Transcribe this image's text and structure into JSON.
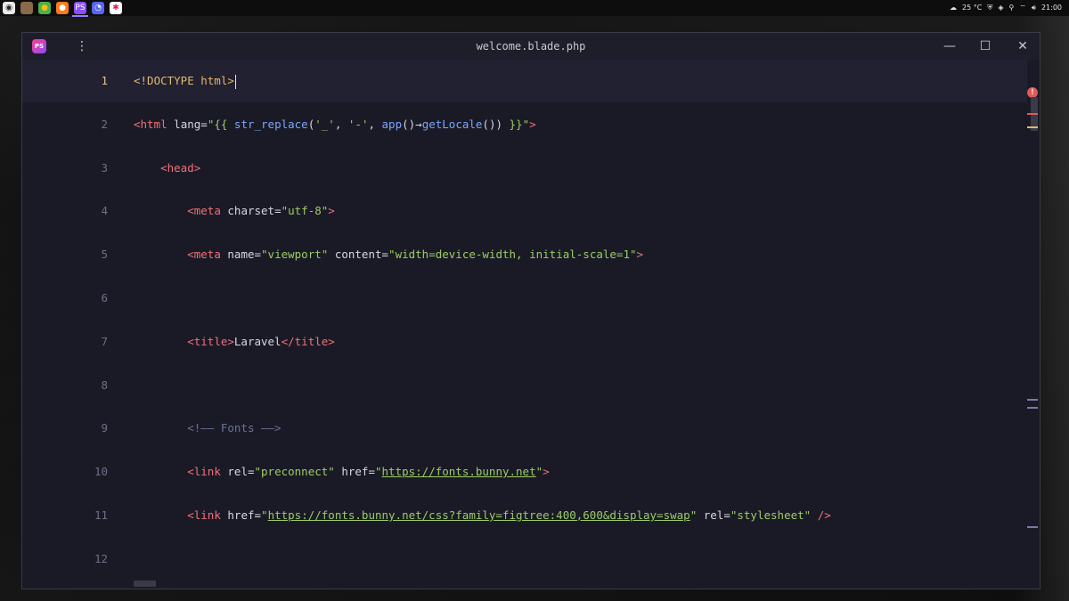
{
  "taskbar": {
    "apps": [
      {
        "name": "linux-mint-menu-icon",
        "glyph": "◉",
        "bg": "#e9e9e9",
        "fg": "#222"
      },
      {
        "name": "files-icon",
        "glyph": "▬",
        "bg": "#8a6a4a",
        "fg": "#8a6a4a"
      },
      {
        "name": "chrome-icon",
        "glyph": "●",
        "bg": "#4caf50",
        "fg": "#f4c20d"
      },
      {
        "name": "firefox-icon",
        "glyph": "●",
        "bg": "#ff7a1a",
        "fg": "#fff"
      },
      {
        "name": "phpstorm-icon",
        "glyph": "PS",
        "bg": "#8b4dff",
        "fg": "#fff"
      },
      {
        "name": "discord-icon",
        "glyph": "◔",
        "bg": "#5865f2",
        "fg": "#fff"
      },
      {
        "name": "slack-icon",
        "glyph": "✱",
        "bg": "#ffffff",
        "fg": "#e01e5a"
      }
    ],
    "weather": "25 °C",
    "clock": "21:00"
  },
  "window": {
    "title": "welcome.blade.php"
  },
  "editor": {
    "lines": [
      {
        "n": "1",
        "html": "<span class=\"doctype\">&lt;!DOCTYPE html&gt;</span><span class=\"cursor\"></span>"
      },
      {
        "n": "2",
        "html": "<span class=\"tag\">&lt;html</span> <span class=\"attr\">lang</span>=<span class=\"str\">\"{{ </span><span class=\"fn\">str_replace</span><span class=\"op\">(</span><span class=\"str\">'_'</span>, <span class=\"str\">'-'</span>, <span class=\"fn\">app</span>()→<span class=\"fn\">getLocale</span>()) <span class=\"str\">}}\"</span><span class=\"tag\">&gt;</span>"
      },
      {
        "n": "3",
        "html": "    <span class=\"tag\">&lt;head&gt;</span>"
      },
      {
        "n": "4",
        "html": "        <span class=\"tag\">&lt;meta</span> <span class=\"attr\">charset</span>=<span class=\"str\">\"utf-8\"</span><span class=\"tag\">&gt;</span>"
      },
      {
        "n": "5",
        "html": "        <span class=\"tag\">&lt;meta</span> <span class=\"attr\">name</span>=<span class=\"str\">\"viewport\"</span> <span class=\"attr\">content</span>=<span class=\"str\">\"width=device-width, initial-scale=1\"</span><span class=\"tag\">&gt;</span>"
      },
      {
        "n": "6",
        "html": ""
      },
      {
        "n": "7",
        "html": "        <span class=\"tag\">&lt;title&gt;</span>Laravel<span class=\"tag\">&lt;/title&gt;</span>"
      },
      {
        "n": "8",
        "html": ""
      },
      {
        "n": "9",
        "html": "        <span class=\"comment\">&lt;!—— Fonts ——&gt;</span>"
      },
      {
        "n": "10",
        "html": "        <span class=\"tag\">&lt;link</span> <span class=\"attr\">rel</span>=<span class=\"str\">\"preconnect\"</span> <span class=\"attr\">href</span>=<span class=\"str\">\"</span><span class=\"url\">https://fonts.bunny.net</span><span class=\"str\">\"</span><span class=\"tag\">&gt;</span>"
      },
      {
        "n": "11",
        "html": "        <span class=\"tag\">&lt;link</span> <span class=\"attr\">href</span>=<span class=\"str\">\"</span><span class=\"url\">https://fonts.bunny.net/css?family=figtree:400,600&amp;display=swap</span><span class=\"str\">\"</span> <span class=\"attr\">rel</span>=<span class=\"str\">\"stylesheet\"</span> <span class=\"tag\">/&gt;</span>"
      },
      {
        "n": "12",
        "html": ""
      }
    ],
    "current_line": 1
  },
  "colors": {
    "window_bg": "#1a1a26",
    "current_line_bg": "#212131",
    "tag": "#f07178",
    "string": "#9ccc65",
    "function": "#7aa6ff",
    "comment": "#6b7396",
    "error_badge": "#e05a5a"
  },
  "markers": [
    {
      "color": "#e05a5a"
    },
    {
      "color": "#e2b86b"
    },
    {
      "color": "#7a7aa8"
    },
    {
      "color": "#7a7aa8"
    },
    {
      "color": "#7a7aa8"
    }
  ]
}
